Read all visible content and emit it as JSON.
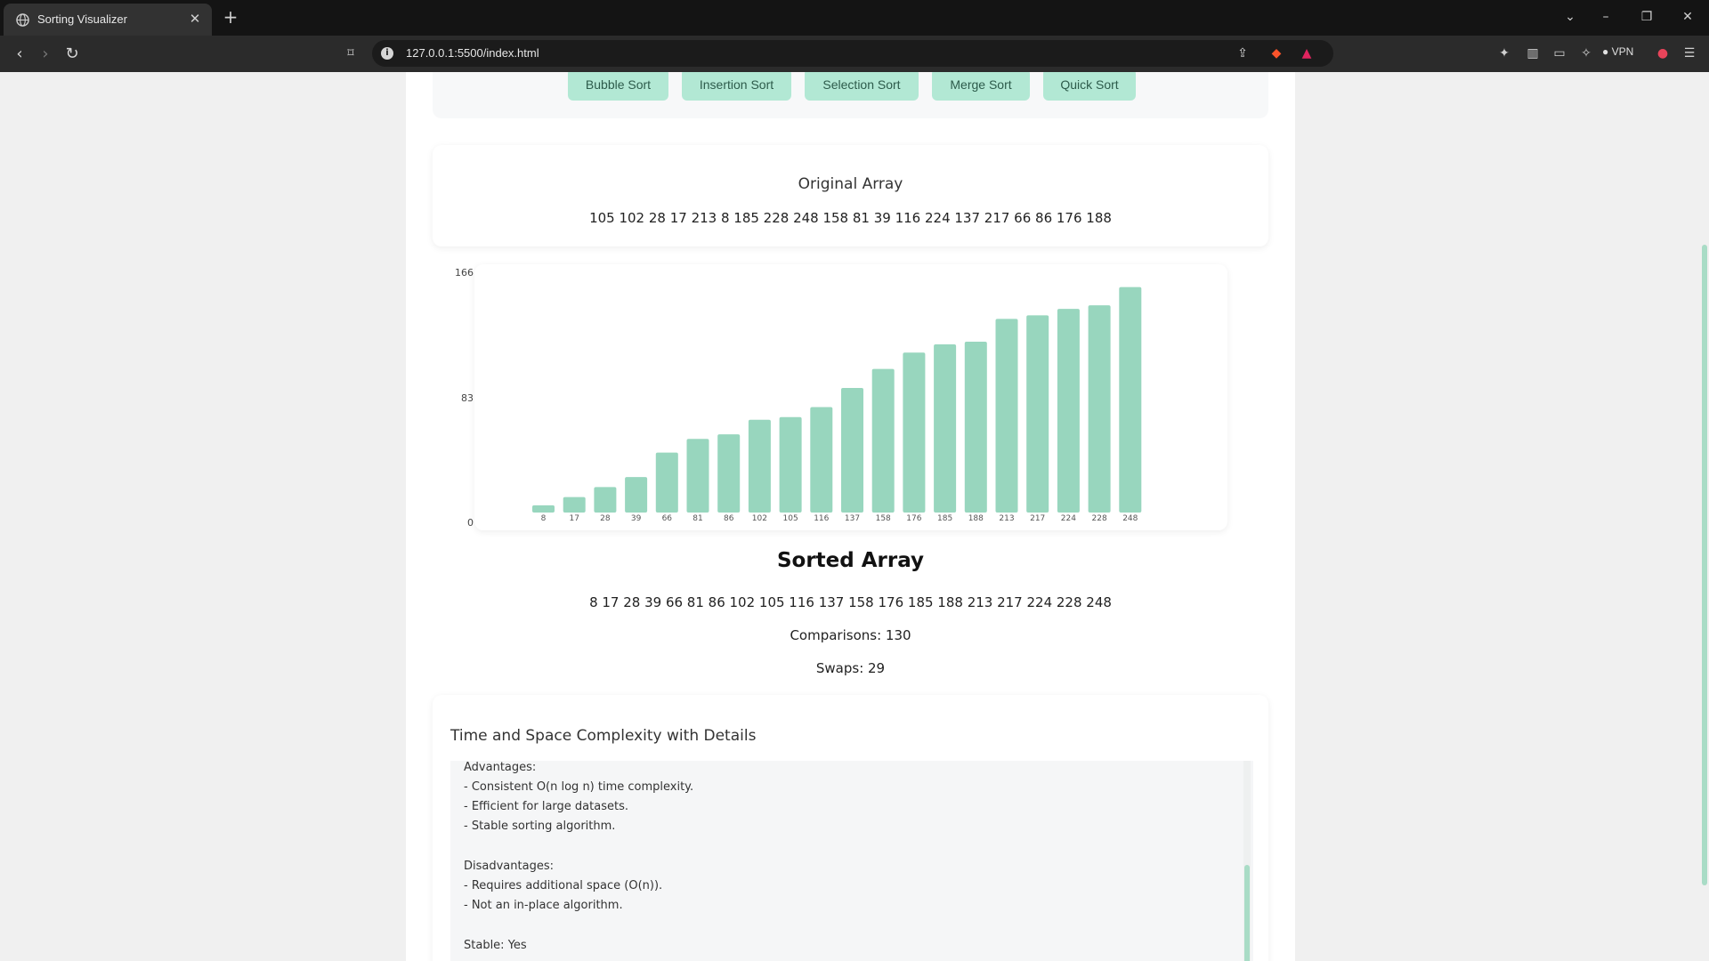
{
  "browser": {
    "tab_title": "Sorting Visualizer",
    "url": "127.0.0.1:5500/index.html",
    "vpn_label": "VPN"
  },
  "buttons": [
    "Bubble Sort",
    "Insertion Sort",
    "Selection Sort",
    "Merge Sort",
    "Quick Sort"
  ],
  "original": {
    "heading": "Original Array",
    "values": "105 102 28 17 213 8 185 228 248 158 81 39 116 224 137 217 66 86 176 188"
  },
  "chart_data": {
    "type": "bar",
    "categories": [
      "8",
      "17",
      "28",
      "39",
      "66",
      "81",
      "86",
      "102",
      "105",
      "116",
      "137",
      "158",
      "176",
      "185",
      "188",
      "213",
      "217",
      "224",
      "228",
      "248"
    ],
    "values": [
      8,
      17,
      28,
      39,
      66,
      81,
      86,
      102,
      105,
      116,
      137,
      158,
      176,
      185,
      188,
      213,
      217,
      224,
      228,
      248
    ],
    "y_ticks": [
      "0",
      "83",
      "166"
    ],
    "ylim": [
      0,
      282
    ],
    "color": "#98d6be",
    "grid": false
  },
  "sorted": {
    "heading": "Sorted Array",
    "values": "8 17 28 39 66 81 86 102 105 116 137 158 176 185 188 213 217 224 228 248",
    "comparisons": "Comparisons: 130",
    "swaps": "Swaps: 29"
  },
  "complexity": {
    "title": "Time and Space Complexity with Details",
    "lines": [
      "Advantages:",
      "- Consistent O(n log n) time complexity.",
      "- Efficient for large datasets.",
      "- Stable sorting algorithm.",
      "",
      "Disadvantages:",
      "- Requires additional space (O(n)).",
      "- Not an in-place algorithm.",
      "",
      "Stable: Yes"
    ]
  },
  "colors": {
    "accent": "#b2e8d4",
    "bar": "#98d6be",
    "page_bg": "#f0f0f0"
  }
}
